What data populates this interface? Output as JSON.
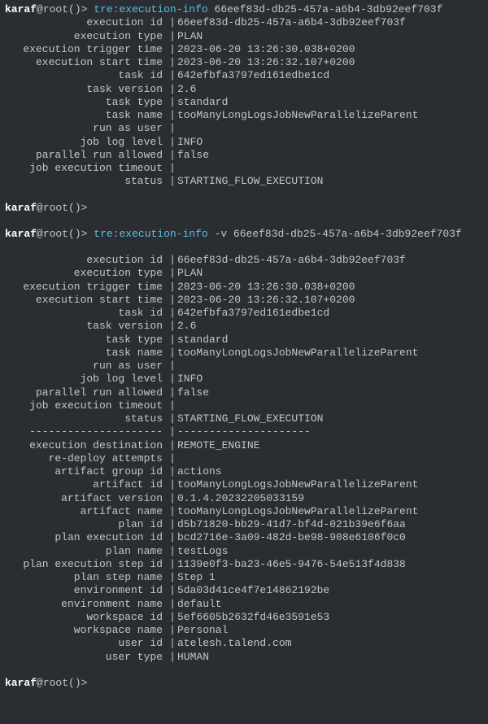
{
  "prompt": {
    "user": "karaf",
    "at": "@",
    "host": "root",
    "parens": "()",
    "arrow": ">"
  },
  "commands": {
    "cmd1": "tre:execution-info",
    "arg1": " 66eef83d-db25-457a-a6b4-3db92eef703f",
    "cmd2": "tre:execution-info",
    "flag2": " -v 66eef83d-db25-457a-a6b4-3db92eef703f"
  },
  "block1": [
    {
      "k": "execution id",
      "v": "66eef83d-db25-457a-a6b4-3db92eef703f"
    },
    {
      "k": "execution type",
      "v": "PLAN"
    },
    {
      "k": "execution trigger time",
      "v": "2023-06-20 13:26:30.038+0200"
    },
    {
      "k": "execution start time",
      "v": "2023-06-20 13:26:32.107+0200"
    },
    {
      "k": "task id",
      "v": "642efbfa3797ed161edbe1cd"
    },
    {
      "k": "task version",
      "v": "2.6"
    },
    {
      "k": "task type",
      "v": "standard"
    },
    {
      "k": "task name",
      "v": "tooManyLongLogsJobNewParallelizeParent"
    },
    {
      "k": "run as user",
      "v": ""
    },
    {
      "k": "job log level",
      "v": "INFO"
    },
    {
      "k": "parallel run allowed",
      "v": "false"
    },
    {
      "k": "job execution timeout",
      "v": ""
    },
    {
      "k": "status",
      "v": "STARTING_FLOW_EXECUTION"
    }
  ],
  "block2a": [
    {
      "k": "execution id",
      "v": "66eef83d-db25-457a-a6b4-3db92eef703f"
    },
    {
      "k": "execution type",
      "v": "PLAN"
    },
    {
      "k": "execution trigger time",
      "v": "2023-06-20 13:26:30.038+0200"
    },
    {
      "k": "execution start time",
      "v": "2023-06-20 13:26:32.107+0200"
    },
    {
      "k": "task id",
      "v": "642efbfa3797ed161edbe1cd"
    },
    {
      "k": "task version",
      "v": "2.6"
    },
    {
      "k": "task type",
      "v": "standard"
    },
    {
      "k": "task name",
      "v": "tooManyLongLogsJobNewParallelizeParent"
    },
    {
      "k": "run as user",
      "v": ""
    },
    {
      "k": "job log level",
      "v": "INFO"
    },
    {
      "k": "parallel run allowed",
      "v": "false"
    },
    {
      "k": "job execution timeout",
      "v": ""
    },
    {
      "k": "status",
      "v": "STARTING_FLOW_EXECUTION"
    }
  ],
  "divider": {
    "left": "---------------------",
    "right": "---------------------"
  },
  "block2b": [
    {
      "k": "execution destination",
      "v": "REMOTE_ENGINE"
    },
    {
      "k": "re-deploy attempts",
      "v": ""
    },
    {
      "k": "artifact group id",
      "v": "actions"
    },
    {
      "k": "artifact id",
      "v": "tooManyLongLogsJobNewParallelizeParent"
    },
    {
      "k": "artifact version",
      "v": "0.1.4.20232205033159"
    },
    {
      "k": "artifact name",
      "v": "tooManyLongLogsJobNewParallelizeParent"
    },
    {
      "k": "plan id",
      "v": "d5b71820-bb29-41d7-bf4d-021b39e6f6aa"
    },
    {
      "k": "plan execution id",
      "v": "bcd2716e-3a09-482d-be98-908e6106f0c0"
    },
    {
      "k": "plan name",
      "v": "testLogs"
    },
    {
      "k": "plan execution step id",
      "v": "1139e0f3-ba23-46e5-9476-54e513f4d838"
    },
    {
      "k": "plan step name",
      "v": "Step 1"
    },
    {
      "k": "environment id",
      "v": "5da03d41ce4f7e14862192be"
    },
    {
      "k": "environment name",
      "v": "default"
    },
    {
      "k": "workspace id",
      "v": "5ef6605b2632fd46e3591e53"
    },
    {
      "k": "workspace name",
      "v": "Personal"
    },
    {
      "k": "user id",
      "v": "atelesh.talend.com"
    },
    {
      "k": "user type",
      "v": "HUMAN"
    }
  ]
}
